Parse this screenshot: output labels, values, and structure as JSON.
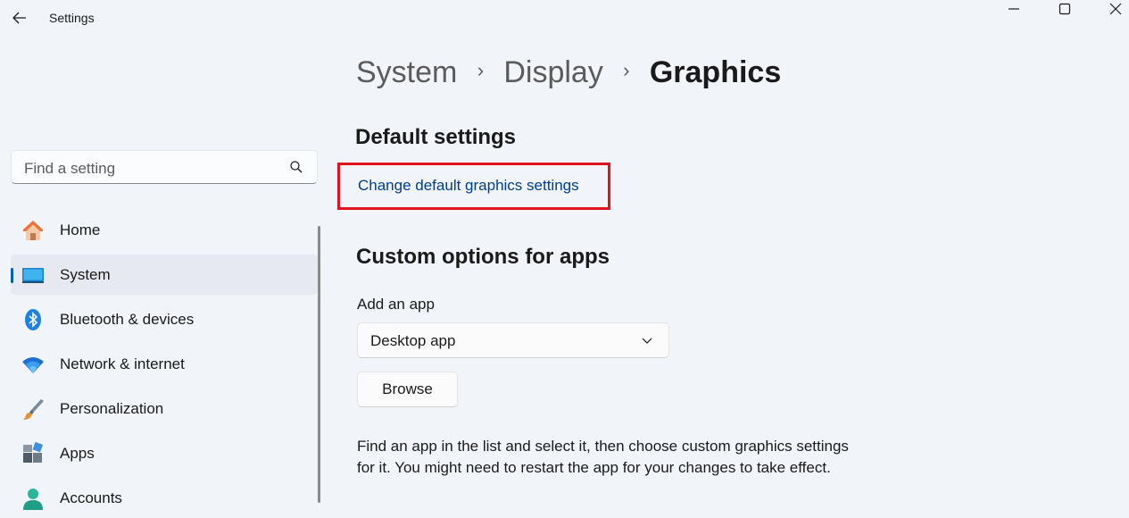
{
  "window": {
    "title": "Settings"
  },
  "search": {
    "placeholder": "Find a setting",
    "value": ""
  },
  "sidebar": {
    "items": [
      {
        "label": "Home",
        "icon": "home-icon",
        "selected": false
      },
      {
        "label": "System",
        "icon": "system-icon",
        "selected": true
      },
      {
        "label": "Bluetooth & devices",
        "icon": "bluetooth-icon",
        "selected": false
      },
      {
        "label": "Network & internet",
        "icon": "wifi-icon",
        "selected": false
      },
      {
        "label": "Personalization",
        "icon": "brush-icon",
        "selected": false
      },
      {
        "label": "Apps",
        "icon": "apps-icon",
        "selected": false
      },
      {
        "label": "Accounts",
        "icon": "account-icon",
        "selected": false
      }
    ]
  },
  "breadcrumb": {
    "items": [
      "System",
      "Display",
      "Graphics"
    ],
    "separator": "›"
  },
  "main": {
    "default_settings": {
      "heading": "Default settings",
      "link": "Change default graphics settings"
    },
    "custom_options": {
      "heading": "Custom options for apps",
      "add_label": "Add an app",
      "dropdown_value": "Desktop app",
      "browse_label": "Browse",
      "description": "Find an app in the list and select it, then choose custom graphics settings for it. You might need to restart the app for your changes to take effect."
    }
  },
  "colors": {
    "accent": "#005fb8",
    "link": "#003e92",
    "highlight_box": "#e0141e",
    "background": "#f1f4f9"
  }
}
